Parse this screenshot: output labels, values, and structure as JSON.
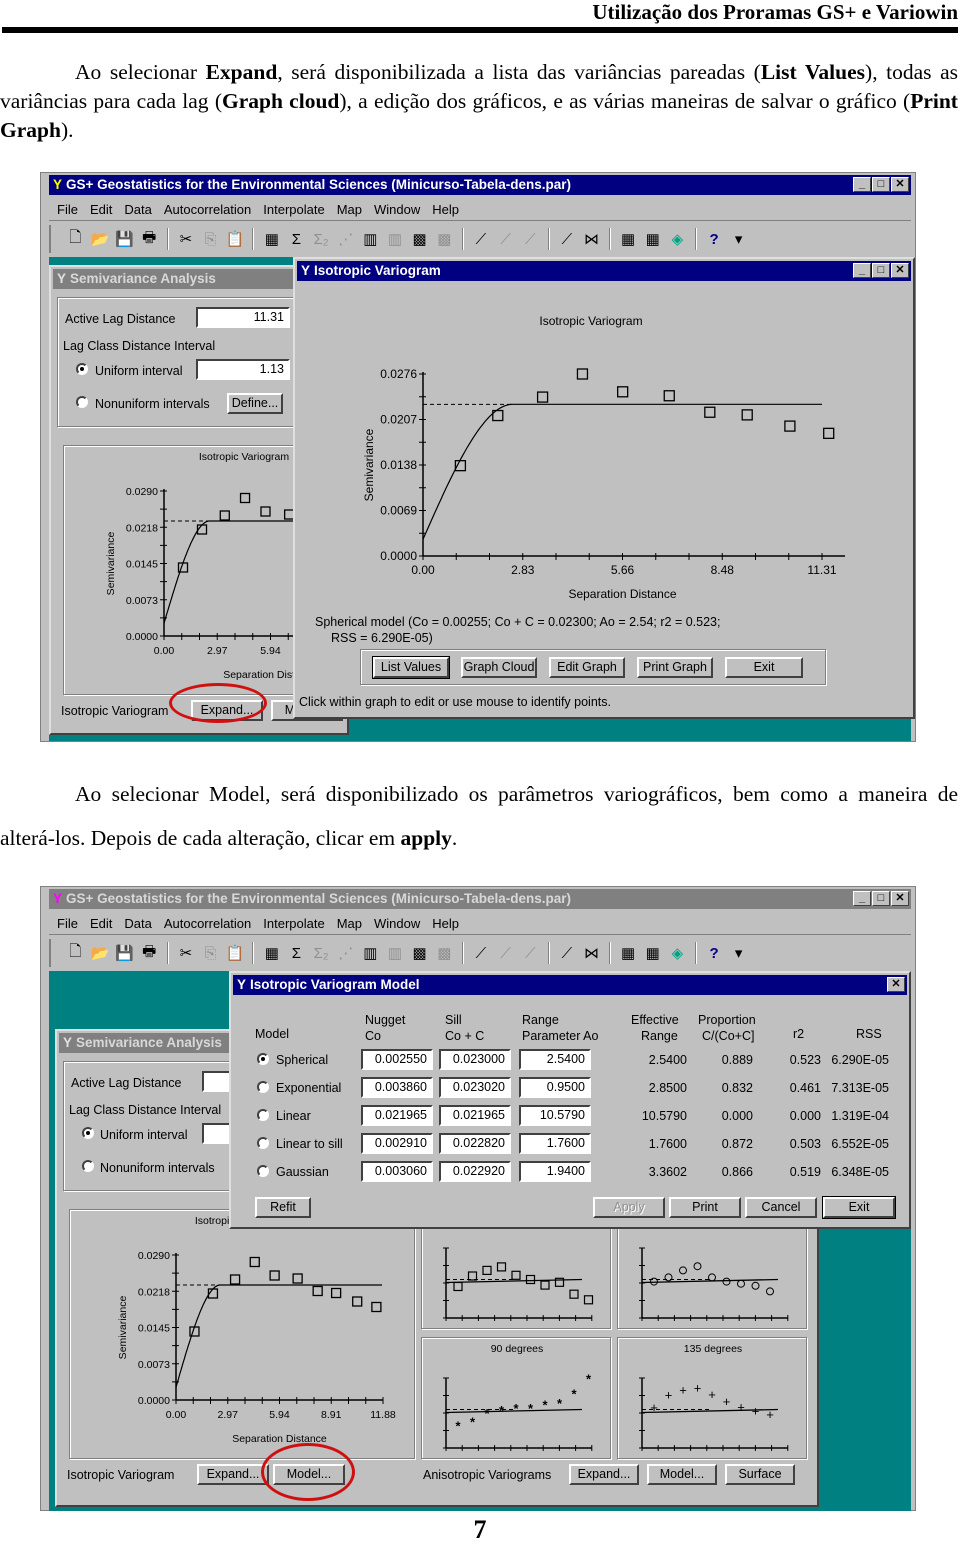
{
  "header": "Utilização dos Proramas GS+ e Variowin",
  "para1": {
    "p1": "Ao selecionar ",
    "b1": "Expand",
    "p2": ", será disponibilizada a lista das variâncias pareadas (",
    "b2": "List Values",
    "p3": "), todas as variâncias para cada lag (",
    "b3": "Graph cloud",
    "p4": "), a edição dos gráficos, e as várias maneiras de salvar o gráfico (",
    "b4": "Print Graph",
    "p5": ")."
  },
  "para2": {
    "p1": "Ao selecionar Model, será disponibilizado os parâmetros variográficos, bem como a maneira de alterá-los. Depois de cada alteração, clicar em ",
    "b1": "apply",
    "p2": "."
  },
  "page_number": "7",
  "app": {
    "title": "GS+ Geostatistics for the Environmental Sciences (Minicurso-Tabela-dens.par)",
    "menu": [
      "File",
      "Edit",
      "Data",
      "Autocorrelation",
      "Interpolate",
      "Map",
      "Window",
      "Help"
    ],
    "toolbar_icons": [
      "new-icon",
      "open-icon",
      "save-icon",
      "print-icon",
      "|",
      "cut-icon",
      "copy-icon",
      "paste-icon",
      "|",
      "table-icon",
      "sigma-icon",
      "sigma2-icon",
      "scatter-icon",
      "histogram-icon",
      "histogram2-icon",
      "map-icon",
      "map2-icon",
      "|",
      "variogram-s-icon",
      "variogram-s2-icon",
      "variogram-sx-icon",
      "|",
      "fractal-icon",
      "madogram-icon",
      "|",
      "kriging-icon",
      "idw-icon",
      "surface-icon",
      "|",
      "help-icon",
      "dropdown-icon"
    ]
  },
  "semivariance": {
    "title": "Semivariance Analysis",
    "active_lag_label": "Active Lag Distance",
    "active_lag_value": "11.31",
    "lag_class_label": "Lag Class Distance Interval",
    "uniform_label": "Uniform interval",
    "uniform_value": "1.13",
    "nonuniform_label": "Nonuniform intervals",
    "define_label": "Define...",
    "iso_label": "Isotropic Variogram",
    "expand_label": "Expand...",
    "model_label": "Model...",
    "mini_title": "Isotropic Variogram",
    "aniso_label": "Anisotropic Variograms",
    "surface_label": "Surface",
    "deg90": "90 degrees",
    "deg135": "135 degrees"
  },
  "iso_window": {
    "title": "Isotropic Variogram",
    "model_text_1": "Spherical model (Co = 0.00255; Co + C = 0.02300; Ao = 2.54; r2 = 0.523;",
    "model_text_2": "RSS = 6.290E-05)",
    "buttons": [
      "List Values",
      "Graph Cloud",
      "Edit Graph",
      "Print Graph",
      "Exit"
    ],
    "status": "Click within graph to edit or use mouse to identify points."
  },
  "model_window": {
    "title": "Isotropic Variogram Model",
    "headers": {
      "model": "Model",
      "nugget": [
        "Nugget",
        "Co"
      ],
      "sill": [
        "Sill",
        "Co + C"
      ],
      "range": [
        "Range",
        "Parameter Ao"
      ],
      "eff": [
        "Effective",
        "Range"
      ],
      "prop": [
        "Proportion",
        "C/(Co+C]"
      ],
      "r2": "r2",
      "rss": "RSS"
    },
    "rows": [
      {
        "model": "Spherical",
        "selected": true,
        "nugget": "0.002550",
        "sill": "0.023000",
        "range": "2.5400",
        "eff": "2.5400",
        "prop": "0.889",
        "r2": "0.523",
        "rss": "6.290E-05"
      },
      {
        "model": "Exponential",
        "selected": false,
        "nugget": "0.003860",
        "sill": "0.023020",
        "range": "0.9500",
        "eff": "2.8500",
        "prop": "0.832",
        "r2": "0.461",
        "rss": "7.313E-05"
      },
      {
        "model": "Linear",
        "selected": false,
        "nugget": "0.021965",
        "sill": "0.021965",
        "range": "10.5790",
        "eff": "10.5790",
        "prop": "0.000",
        "r2": "0.000",
        "rss": "1.319E-04"
      },
      {
        "model": "Linear to sill",
        "selected": false,
        "nugget": "0.002910",
        "sill": "0.022820",
        "range": "1.7600",
        "eff": "1.7600",
        "prop": "0.872",
        "r2": "0.503",
        "rss": "6.552E-05"
      },
      {
        "model": "Gaussian",
        "selected": false,
        "nugget": "0.003060",
        "sill": "0.022920",
        "range": "1.9400",
        "eff": "3.3602",
        "prop": "0.866",
        "r2": "0.519",
        "rss": "6.348E-05"
      }
    ],
    "buttons": {
      "refit": "Refit",
      "apply": "Apply",
      "print": "Print",
      "cancel": "Cancel",
      "exit": "Exit"
    }
  },
  "chart_data": [
    {
      "id": "large",
      "type": "scatter",
      "title": "Isotropic Variogram",
      "xlabel": "Separation Distance",
      "ylabel": "Semivariance",
      "xlim": [
        0,
        11.31
      ],
      "ylim": [
        0,
        0.0276
      ],
      "xticks": [
        "0.00",
        "2.83",
        "5.66",
        "8.48",
        "11.31"
      ],
      "yticks": [
        "0.0000",
        "0.0069",
        "0.0138",
        "0.0207",
        "0.0276"
      ],
      "x": [
        1.06,
        2.12,
        3.39,
        4.52,
        5.66,
        6.98,
        8.13,
        9.19,
        10.4,
        11.5
      ],
      "y": [
        0.0137,
        0.0213,
        0.0241,
        0.0276,
        0.0249,
        0.0243,
        0.0218,
        0.0214,
        0.0197,
        0.0186
      ],
      "model": {
        "type": "spherical",
        "nugget": 0.00255,
        "sill": 0.023,
        "range": 2.54
      }
    },
    {
      "id": "small",
      "type": "scatter",
      "title": "Isotropic Variogram",
      "xlabel": "Separation Distance",
      "ylabel": "Semivariance",
      "xlim": [
        0,
        11.88
      ],
      "ylim": [
        0,
        0.029
      ],
      "xticks": [
        "0.00",
        "2.97",
        "5.94",
        "8.91",
        "11.88"
      ],
      "yticks": [
        "0.0000",
        "0.0073",
        "0.0145",
        "0.0218",
        "0.0290"
      ],
      "x": [
        1.06,
        2.12,
        3.39,
        4.52,
        5.66,
        6.98,
        8.13,
        9.19,
        10.4,
        11.5
      ],
      "y": [
        0.0137,
        0.0213,
        0.0241,
        0.0276,
        0.0249,
        0.0243,
        0.0218,
        0.0214,
        0.0197,
        0.0186
      ],
      "model": {
        "type": "spherical",
        "nugget": 0.00255,
        "sill": 0.023,
        "range": 2.54
      }
    },
    {
      "id": "aniso0",
      "type": "scatter",
      "title": "",
      "marker": "square",
      "y": [
        0.45,
        0.6,
        0.68,
        0.73,
        0.61,
        0.55,
        0.47,
        0.51,
        0.34,
        0.26
      ]
    },
    {
      "id": "aniso45",
      "type": "scatter",
      "title": "",
      "marker": "circle",
      "y": [
        0.52,
        0.58,
        0.68,
        0.74,
        0.58,
        0.52,
        0.49,
        0.46,
        0.38
      ]
    },
    {
      "id": "aniso90",
      "type": "scatter",
      "title": "90 degrees",
      "marker": "star",
      "y": [
        0.32,
        0.38,
        0.5,
        0.54,
        0.57,
        0.57,
        0.62,
        0.64,
        0.78,
        0.99
      ]
    },
    {
      "id": "aniso135",
      "type": "scatter",
      "title": "135 degrees",
      "marker": "plus",
      "y": [
        0.57,
        0.75,
        0.82,
        0.85,
        0.76,
        0.66,
        0.58,
        0.52,
        0.47
      ]
    }
  ]
}
